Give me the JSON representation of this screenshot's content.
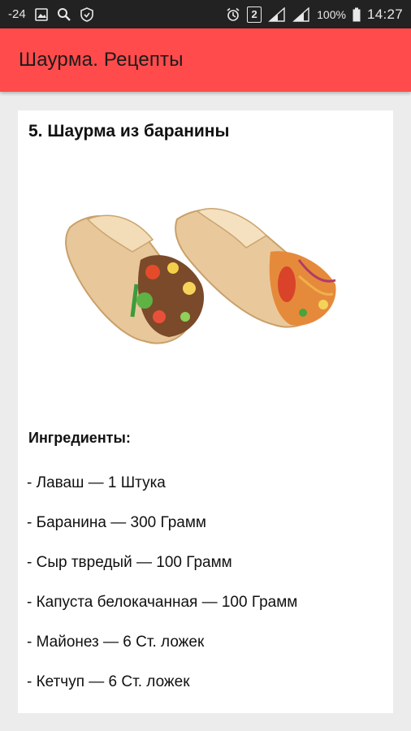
{
  "status_bar": {
    "signal_left": "-24",
    "sim_slot": "2",
    "battery_percent": "100%",
    "time": "14:27",
    "icons": [
      "image-icon",
      "search-icon",
      "shield-icon",
      "alarm-icon",
      "sim-icon",
      "signal-icon",
      "signal-icon",
      "battery-icon"
    ]
  },
  "app_bar": {
    "title": "Шаурма. Рецепты",
    "color": "#ff4b4b"
  },
  "recipe": {
    "title": "5. Шаурма из баранины",
    "image_icon": "shawarma-image",
    "ingredients_heading": "Ингредиенты:",
    "ingredients": [
      "- Лаваш — 1 Штука",
      "- Баранина — 300 Грамм",
      "- Сыр твредый — 100 Грамм",
      "- Капуста белокачанная — 100 Грамм",
      "- Майонез — 6 Ст. ложек",
      "- Кетчуп — 6 Ст. ложек"
    ]
  }
}
